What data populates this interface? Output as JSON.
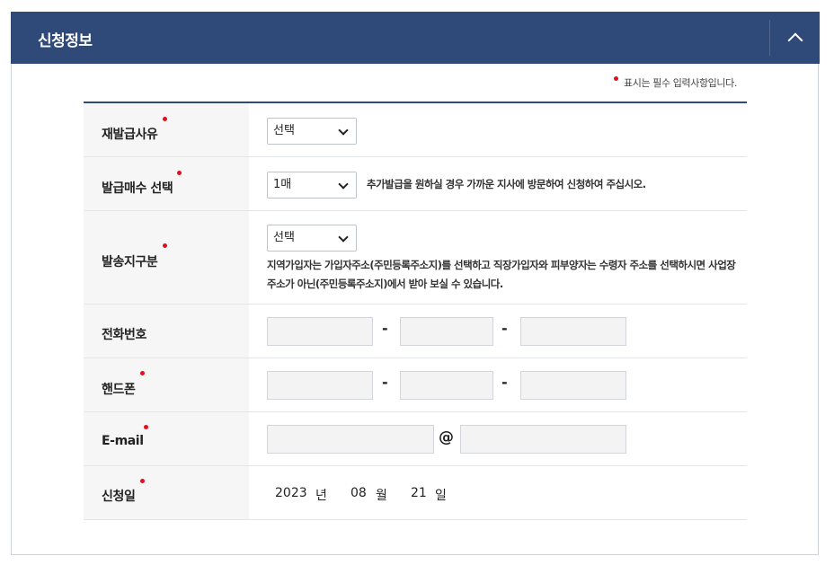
{
  "header": {
    "title": "신청정보"
  },
  "required_note": "표시는 필수 입력사항입니다.",
  "fields": {
    "reissue_reason": {
      "label": "재발급사유",
      "selected": "선택"
    },
    "copies": {
      "label": "발급매수 선택",
      "selected": "1매",
      "hint": "추가발급을 원하실 경우 가까운 지사에 방문하여 신청하여 주십시오."
    },
    "delivery": {
      "label": "발송지구분",
      "selected": "선택",
      "hint": "지역가입자는 가입자주소(주민등록주소지)를 선택하고 직장가입자와 피부양자는 수령자 주소를 선택하시면 사업장 주소가 아닌(주민등록주소지)에서 받아 보실 수 있습니다."
    },
    "phone": {
      "label": "전화번호",
      "sep": "-"
    },
    "mobile": {
      "label": "핸드폰",
      "sep": "-"
    },
    "email": {
      "label": "E-mail",
      "at": "@"
    },
    "apply_date": {
      "label": "신청일",
      "year": "2023",
      "year_unit": "년",
      "month": "08",
      "month_unit": "월",
      "day": "21",
      "day_unit": "일"
    }
  },
  "colors": {
    "header_bg": "#2f4a78",
    "required_dot": "#e01020",
    "label_bg": "#f6f6f6",
    "input_bg": "#f3f3f3"
  }
}
